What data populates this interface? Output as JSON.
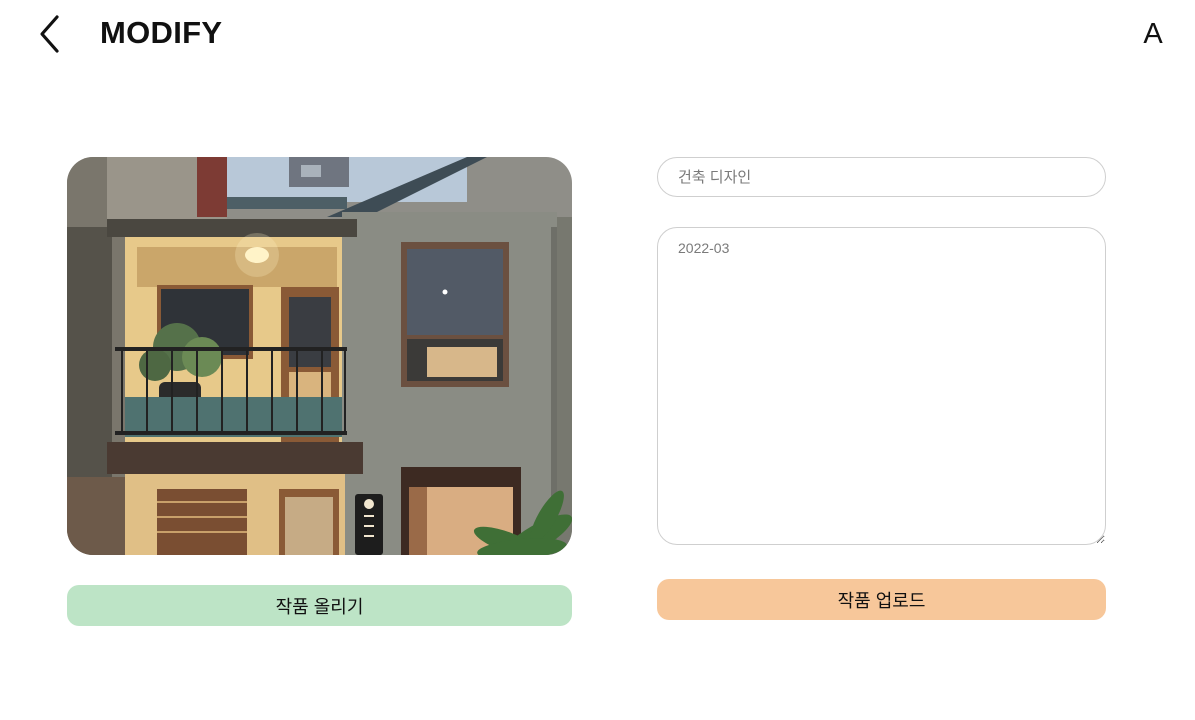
{
  "header": {
    "title": "MODIFY",
    "avatar_letter": "A",
    "back_icon": "chevron-left-icon"
  },
  "artwork": {
    "image": "building-facade-photo"
  },
  "form": {
    "title_placeholder": "건축 디자인",
    "description_placeholder": "2022-03"
  },
  "buttons": {
    "post_label": "작품 올리기",
    "upload_label": "작품 업로드"
  },
  "colors": {
    "post_button": "#bde4c6",
    "upload_button": "#f7c79a",
    "input_border": "#cfcfcf"
  }
}
